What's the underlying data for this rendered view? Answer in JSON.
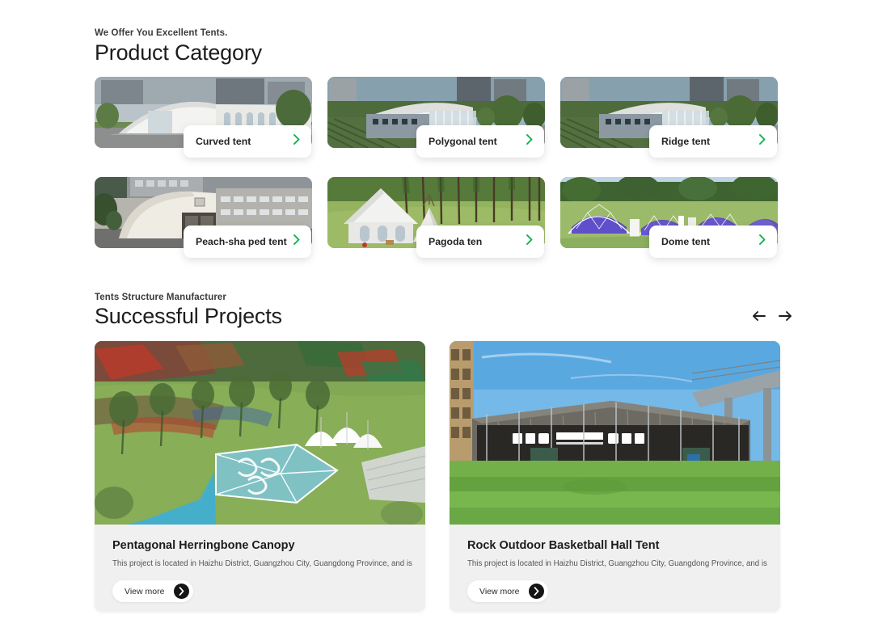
{
  "theme": {
    "page_bg": "#ffffff",
    "accent_green": "#0db14b",
    "card_bg": "#f0f0f0",
    "text_dark": "#1d1d1d"
  },
  "product_section": {
    "eyebrow": "We Offer You Excellent Tents.",
    "headline": "Product Category",
    "categories": [
      {
        "label": "Curved tent",
        "chevron_icon": "chevron-right-icon"
      },
      {
        "label": "Polygonal tent",
        "chevron_icon": "chevron-right-icon"
      },
      {
        "label": "Ridge tent",
        "chevron_icon": "chevron-right-icon"
      },
      {
        "label": "Peach-sha ped tent",
        "chevron_icon": "chevron-right-icon"
      },
      {
        "label": "Pagoda ten",
        "chevron_icon": "chevron-right-icon"
      },
      {
        "label": "Dome tent",
        "chevron_icon": "chevron-right-icon"
      }
    ]
  },
  "projects_section": {
    "eyebrow": "Tents Structure Manufacturer",
    "headline": "Successful Projects",
    "nav": {
      "prev_icon": "arrow-left-icon",
      "next_icon": "arrow-right-icon"
    },
    "projects": [
      {
        "title": "Pentagonal Herringbone Canopy",
        "description": "This project is located in Haizhu District, Guangzhou City, Guangdong Province, and is used for",
        "button_label": "View more",
        "button_icon": "chevron-right-icon"
      },
      {
        "title": "Rock Outdoor Basketball Hall Tent",
        "description": "This project is located in Haizhu District, Guangzhou City, Guangdong Province, and is used for",
        "button_label": "View more",
        "button_icon": "chevron-right-icon"
      }
    ]
  }
}
